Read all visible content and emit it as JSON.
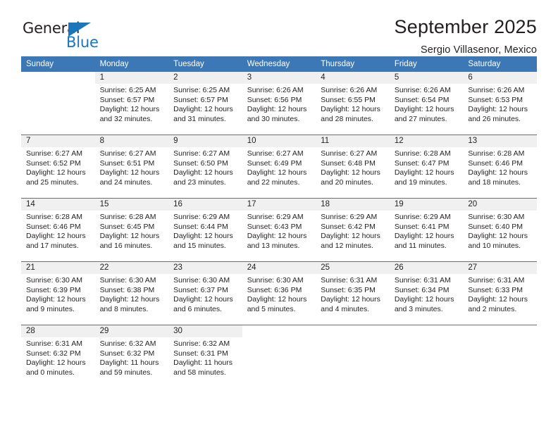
{
  "logo": {
    "word_top": "General",
    "word_bottom": "Blue",
    "accent_color": "#1b75bb"
  },
  "header": {
    "title": "September 2025",
    "subtitle": "Sergio Villasenor, Mexico"
  },
  "theme": {
    "header_blue": "#3b78b5",
    "date_band_gray": "#f0f0f0",
    "text_color": "#231f20"
  },
  "calendar": {
    "weekday_headers": [
      "Sunday",
      "Monday",
      "Tuesday",
      "Wednesday",
      "Thursday",
      "Friday",
      "Saturday"
    ],
    "weeks": [
      [
        {
          "day": "",
          "sunrise": "",
          "sunset": "",
          "daylight": "",
          "empty": true
        },
        {
          "day": "1",
          "sunrise": "Sunrise: 6:25 AM",
          "sunset": "Sunset: 6:57 PM",
          "daylight": "Daylight: 12 hours and 32 minutes."
        },
        {
          "day": "2",
          "sunrise": "Sunrise: 6:25 AM",
          "sunset": "Sunset: 6:57 PM",
          "daylight": "Daylight: 12 hours and 31 minutes."
        },
        {
          "day": "3",
          "sunrise": "Sunrise: 6:26 AM",
          "sunset": "Sunset: 6:56 PM",
          "daylight": "Daylight: 12 hours and 30 minutes."
        },
        {
          "day": "4",
          "sunrise": "Sunrise: 6:26 AM",
          "sunset": "Sunset: 6:55 PM",
          "daylight": "Daylight: 12 hours and 28 minutes."
        },
        {
          "day": "5",
          "sunrise": "Sunrise: 6:26 AM",
          "sunset": "Sunset: 6:54 PM",
          "daylight": "Daylight: 12 hours and 27 minutes."
        },
        {
          "day": "6",
          "sunrise": "Sunrise: 6:26 AM",
          "sunset": "Sunset: 6:53 PM",
          "daylight": "Daylight: 12 hours and 26 minutes."
        }
      ],
      [
        {
          "day": "7",
          "sunrise": "Sunrise: 6:27 AM",
          "sunset": "Sunset: 6:52 PM",
          "daylight": "Daylight: 12 hours and 25 minutes."
        },
        {
          "day": "8",
          "sunrise": "Sunrise: 6:27 AM",
          "sunset": "Sunset: 6:51 PM",
          "daylight": "Daylight: 12 hours and 24 minutes."
        },
        {
          "day": "9",
          "sunrise": "Sunrise: 6:27 AM",
          "sunset": "Sunset: 6:50 PM",
          "daylight": "Daylight: 12 hours and 23 minutes."
        },
        {
          "day": "10",
          "sunrise": "Sunrise: 6:27 AM",
          "sunset": "Sunset: 6:49 PM",
          "daylight": "Daylight: 12 hours and 22 minutes."
        },
        {
          "day": "11",
          "sunrise": "Sunrise: 6:27 AM",
          "sunset": "Sunset: 6:48 PM",
          "daylight": "Daylight: 12 hours and 20 minutes."
        },
        {
          "day": "12",
          "sunrise": "Sunrise: 6:28 AM",
          "sunset": "Sunset: 6:47 PM",
          "daylight": "Daylight: 12 hours and 19 minutes."
        },
        {
          "day": "13",
          "sunrise": "Sunrise: 6:28 AM",
          "sunset": "Sunset: 6:46 PM",
          "daylight": "Daylight: 12 hours and 18 minutes."
        }
      ],
      [
        {
          "day": "14",
          "sunrise": "Sunrise: 6:28 AM",
          "sunset": "Sunset: 6:46 PM",
          "daylight": "Daylight: 12 hours and 17 minutes."
        },
        {
          "day": "15",
          "sunrise": "Sunrise: 6:28 AM",
          "sunset": "Sunset: 6:45 PM",
          "daylight": "Daylight: 12 hours and 16 minutes."
        },
        {
          "day": "16",
          "sunrise": "Sunrise: 6:29 AM",
          "sunset": "Sunset: 6:44 PM",
          "daylight": "Daylight: 12 hours and 15 minutes."
        },
        {
          "day": "17",
          "sunrise": "Sunrise: 6:29 AM",
          "sunset": "Sunset: 6:43 PM",
          "daylight": "Daylight: 12 hours and 13 minutes."
        },
        {
          "day": "18",
          "sunrise": "Sunrise: 6:29 AM",
          "sunset": "Sunset: 6:42 PM",
          "daylight": "Daylight: 12 hours and 12 minutes."
        },
        {
          "day": "19",
          "sunrise": "Sunrise: 6:29 AM",
          "sunset": "Sunset: 6:41 PM",
          "daylight": "Daylight: 12 hours and 11 minutes."
        },
        {
          "day": "20",
          "sunrise": "Sunrise: 6:30 AM",
          "sunset": "Sunset: 6:40 PM",
          "daylight": "Daylight: 12 hours and 10 minutes."
        }
      ],
      [
        {
          "day": "21",
          "sunrise": "Sunrise: 6:30 AM",
          "sunset": "Sunset: 6:39 PM",
          "daylight": "Daylight: 12 hours and 9 minutes."
        },
        {
          "day": "22",
          "sunrise": "Sunrise: 6:30 AM",
          "sunset": "Sunset: 6:38 PM",
          "daylight": "Daylight: 12 hours and 8 minutes."
        },
        {
          "day": "23",
          "sunrise": "Sunrise: 6:30 AM",
          "sunset": "Sunset: 6:37 PM",
          "daylight": "Daylight: 12 hours and 6 minutes."
        },
        {
          "day": "24",
          "sunrise": "Sunrise: 6:30 AM",
          "sunset": "Sunset: 6:36 PM",
          "daylight": "Daylight: 12 hours and 5 minutes."
        },
        {
          "day": "25",
          "sunrise": "Sunrise: 6:31 AM",
          "sunset": "Sunset: 6:35 PM",
          "daylight": "Daylight: 12 hours and 4 minutes."
        },
        {
          "day": "26",
          "sunrise": "Sunrise: 6:31 AM",
          "sunset": "Sunset: 6:34 PM",
          "daylight": "Daylight: 12 hours and 3 minutes."
        },
        {
          "day": "27",
          "sunrise": "Sunrise: 6:31 AM",
          "sunset": "Sunset: 6:33 PM",
          "daylight": "Daylight: 12 hours and 2 minutes."
        }
      ],
      [
        {
          "day": "28",
          "sunrise": "Sunrise: 6:31 AM",
          "sunset": "Sunset: 6:32 PM",
          "daylight": "Daylight: 12 hours and 0 minutes."
        },
        {
          "day": "29",
          "sunrise": "Sunrise: 6:32 AM",
          "sunset": "Sunset: 6:32 PM",
          "daylight": "Daylight: 11 hours and 59 minutes."
        },
        {
          "day": "30",
          "sunrise": "Sunrise: 6:32 AM",
          "sunset": "Sunset: 6:31 PM",
          "daylight": "Daylight: 11 hours and 58 minutes."
        },
        {
          "day": "",
          "sunrise": "",
          "sunset": "",
          "daylight": "",
          "empty": true
        },
        {
          "day": "",
          "sunrise": "",
          "sunset": "",
          "daylight": "",
          "empty": true
        },
        {
          "day": "",
          "sunrise": "",
          "sunset": "",
          "daylight": "",
          "empty": true
        },
        {
          "day": "",
          "sunrise": "",
          "sunset": "",
          "daylight": "",
          "empty": true
        }
      ]
    ]
  }
}
